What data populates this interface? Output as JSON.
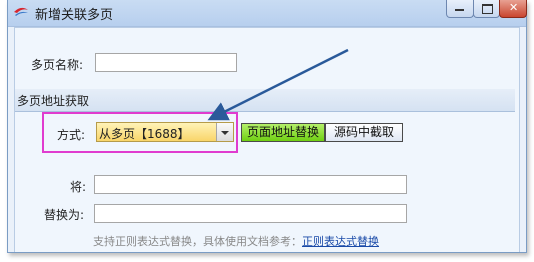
{
  "window": {
    "title": "新增关联多页"
  },
  "form": {
    "page_name_label": "多页名称:",
    "page_name_value": "",
    "section_title": "多页地址获取",
    "mode_label": "方式:",
    "mode_selected": "从多页【1688】",
    "mode_buttons": [
      "页面地址替换",
      "源码中截取"
    ],
    "replace_from_label": "将:",
    "replace_from_value": "",
    "replace_to_label": "替换为:",
    "replace_to_value": "",
    "hint_text": "支持正则表达式替换，具体使用文档参考：",
    "hint_link": "正则表达式替换"
  },
  "colors": {
    "active_button": "#6fcf12",
    "highlight_box": "#e03ccf",
    "arrow": "#2a5a9a",
    "combo": "#f9d56a"
  },
  "icons": {
    "app": "app-logo-icon",
    "minimize": "minimize-icon",
    "maximize": "maximize-icon",
    "close": "close-icon",
    "dropdown": "chevron-down-icon",
    "annotation": "annotation-arrow"
  }
}
